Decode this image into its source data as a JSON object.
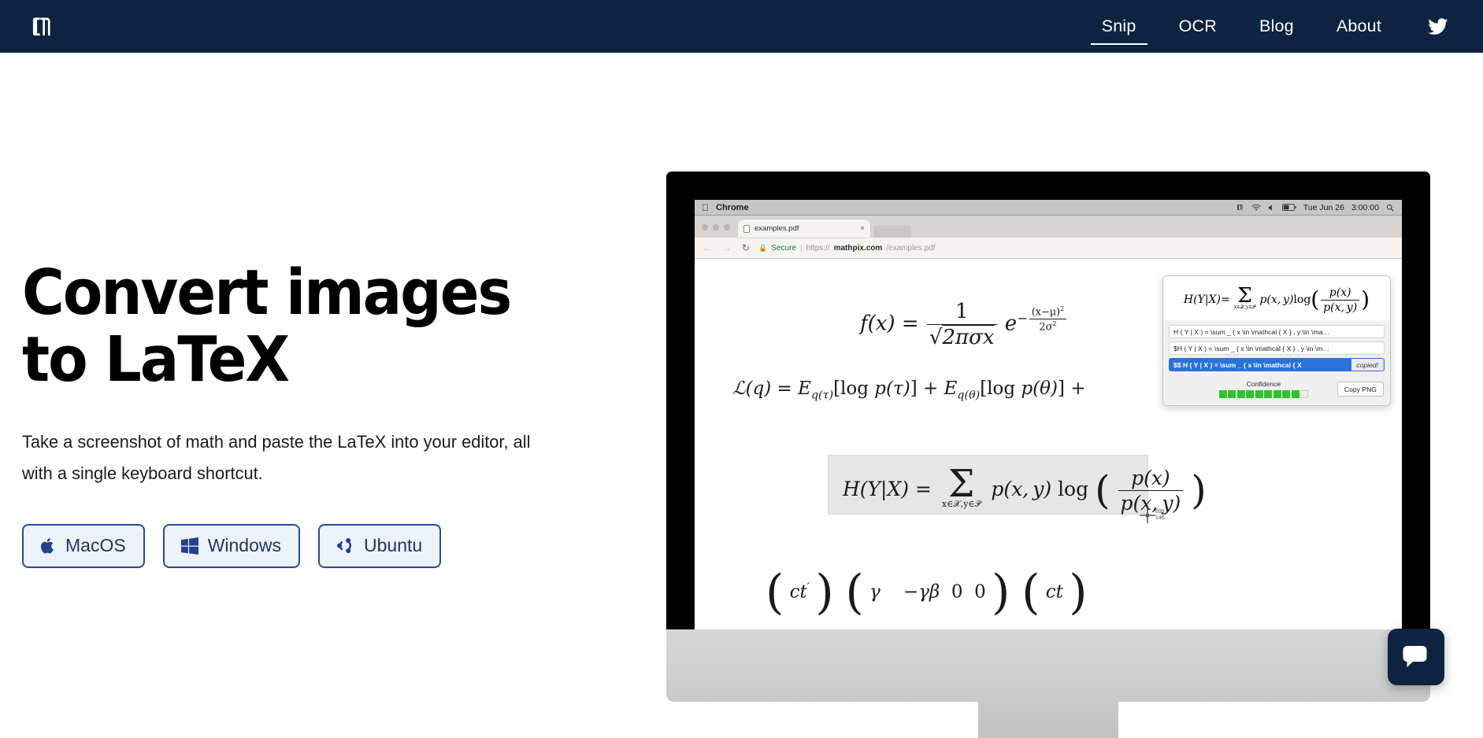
{
  "brand": {
    "logo_icon": "mathpix-logo-icon",
    "name": "Mathpix"
  },
  "nav": {
    "items": [
      {
        "label": "Snip",
        "active": true
      },
      {
        "label": "OCR",
        "active": false
      },
      {
        "label": "Blog",
        "active": false
      },
      {
        "label": "About",
        "active": false
      }
    ],
    "social_icon": "twitter-icon"
  },
  "hero": {
    "title_line1": "Convert images",
    "title_line2": "to LaTeX",
    "subtitle": "Take a screenshot of math and paste the LaTeX into your editor, all with a single keyboard shortcut.",
    "buttons": [
      {
        "label": "MacOS",
        "icon": "apple-icon"
      },
      {
        "label": "Windows",
        "icon": "windows-icon"
      },
      {
        "label": "Ubuntu",
        "icon": "ubuntu-icon"
      }
    ]
  },
  "screenshot": {
    "menubar": {
      "apple_icon": "apple-icon",
      "app_name": "Chrome",
      "status_icons": [
        "mathpix-menubar-icon",
        "wifi-icon",
        "volume-icon",
        "battery-icon"
      ],
      "date": "Tue Jun 26",
      "time": "3:00:00",
      "search_icon": "spotlight-search-icon"
    },
    "browser": {
      "tab_title": "examples.pdf",
      "tab_close_icon": "close-icon",
      "back_icon": "back-arrow-icon",
      "forward_icon": "forward-arrow-icon",
      "reload_icon": "reload-icon",
      "lock_icon": "lock-icon",
      "secure_label": "Secure",
      "url_scheme": "https://",
      "url_domain": "mathpix.com",
      "url_path": "/examples.pdf"
    },
    "pdf": {
      "formula_gaussian": "f(x) = 1 / sqrt(2 pi sigma x) e^{-(x-mu)^2/(2 sigma^2)}",
      "formula_elbo": "L(q) = E_{q(tau)}[log p(tau)] + E_{q(theta)}[log p(theta)] +",
      "formula_selected": "H(Y|X) = sum_{x in X, y in Y} p(x,y) log( p(x) / p(x,y) )",
      "formula_lorentz": "( ct' ) ( gamma  -gamma beta  0  0 ) ( ct )"
    },
    "cursor": {
      "icon": "crosshair-cursor-icon",
      "width_px": "699",
      "height_px": "146"
    },
    "snip_popup": {
      "rendered_formula": "H(Y|X) = sum p(x,y) log(p(x)/p(x,y))",
      "latex_rows": [
        {
          "text": "H ( Y | X ) = \\sum _ { x \\in \\mathcal { X } , y \\in \\ma…",
          "selected": false,
          "badge": ""
        },
        {
          "text": "$H ( Y | X ) = \\sum _ { x \\in \\mathcal { X } , y \\in \\m…",
          "selected": false,
          "badge": ""
        },
        {
          "text": "$$ H ( Y | X ) = \\sum _ { x \\in \\mathcal { X",
          "selected": true,
          "badge": "copied!"
        }
      ],
      "confidence_label": "Confidence",
      "confidence_filled": 9,
      "confidence_total": 10,
      "copy_png_label": "Copy PNG"
    }
  },
  "chat": {
    "icon": "chat-bubble-icon"
  },
  "colors": {
    "navy": "#0d2440",
    "button_blue": "#2b4a9b",
    "button_bg": "#edf1f8",
    "selected_row": "#2b72d8",
    "confidence_green": "#2ec42e",
    "secure_green": "#0b8043"
  }
}
